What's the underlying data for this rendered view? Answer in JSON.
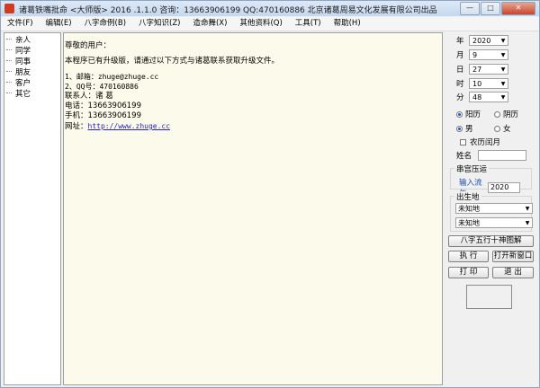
{
  "window": {
    "title": "诸葛铁嘴批命 <大师版> 2016 .1.1.0 咨询：13663906199 QQ:470160886 北京诸葛周易文化发展有限公司出品",
    "buttons": {
      "minimize": "—",
      "maximize": "□",
      "close": "✕"
    }
  },
  "menu": [
    {
      "label": "文件(F)"
    },
    {
      "label": "编辑(E)"
    },
    {
      "label": "八字命例(B)"
    },
    {
      "label": "八字知识(Z)"
    },
    {
      "label": "造命舞(X)"
    },
    {
      "label": "其他资料(Q)"
    },
    {
      "label": "工具(T)"
    },
    {
      "label": "帮助(H)"
    }
  ],
  "categories": [
    {
      "label": "亲人"
    },
    {
      "label": "同学"
    },
    {
      "label": "同事"
    },
    {
      "label": "朋友"
    },
    {
      "label": "客户"
    },
    {
      "label": "其它"
    }
  ],
  "content": {
    "greeting": "尊敬的用户：",
    "message": "本程序已有升级版，请通过以下方式与诸葛联系获取升级文件。",
    "email": "1、邮箱：zhuge@zhuge.cc",
    "qq": "2、QQ号：470160886",
    "contact": "联系人：诸 葛",
    "phone": "电话：13663906199",
    "mobile": "手机：13663906199",
    "website_label": "网址：",
    "website_url": "http://www.zhuge.cc"
  },
  "birth": {
    "year_label": "年",
    "year": "2020",
    "month_label": "月",
    "month": "9",
    "day_label": "日",
    "day": "27",
    "hour_label": "时",
    "hour": "10",
    "minute_label": "分",
    "minute": "48"
  },
  "calendar": {
    "solar": "阳历",
    "lunar": "阴历",
    "selected": "solar"
  },
  "gender": {
    "male": "男",
    "female": "女",
    "selected": "male"
  },
  "leap_month_label": "农历闰月",
  "name_label": "姓名",
  "name_value": "",
  "flow": {
    "group_title": "串宫压运",
    "input_label": "输入流年",
    "year": "2020"
  },
  "birthplace": {
    "group_title": "出生地",
    "province": "未知地",
    "city": "未知地"
  },
  "actions": {
    "diagram": "八字五行十神图解",
    "execute": "执 行",
    "new_window": "打开新窗口",
    "print": "打 印",
    "exit": "退 出"
  },
  "colors": {
    "accent_radio": "#1a58b7",
    "link": "#2222cc",
    "content_bg": "#fcfbeb",
    "flow_label": "#1a4fb0"
  }
}
